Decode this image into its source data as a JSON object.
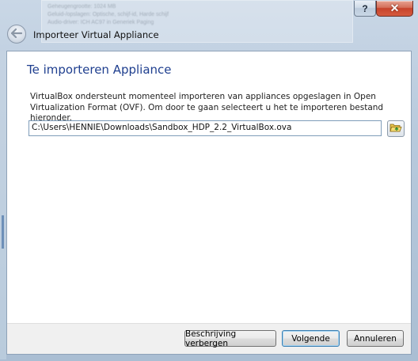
{
  "window": {
    "title": "Importeer Virtual Appliance",
    "help_label": "?",
    "close_label": "✕"
  },
  "background_ghost": {
    "lines": [
      "Geheugengrootte:    1024 MB",
      "Geluid-/opslagen:    Optische, schijf-id, Harde schijf",
      "Audio-driver:    ICH AC97 in Generiek Paging"
    ]
  },
  "page": {
    "heading": "Te importeren Appliance",
    "description": "VirtualBox ondersteunt momenteel importeren van appliances opgeslagen in Open Virtualization Format (OVF). Om door te gaan selecteert u het te importeren bestand hieronder.",
    "file_path": "C:\\Users\\HENNIE\\Downloads\\Sandbox_HDP_2.2_VirtualBox.ova"
  },
  "buttons": {
    "hide_description": "Beschrijving verbergen",
    "next": "Volgende",
    "cancel": "Annuleren"
  },
  "icons": {
    "back": "back-arrow-icon",
    "folder": "open-folder-icon"
  },
  "colors": {
    "heading": "#1f3f8f",
    "default_button_border": "#3c7fb1"
  }
}
